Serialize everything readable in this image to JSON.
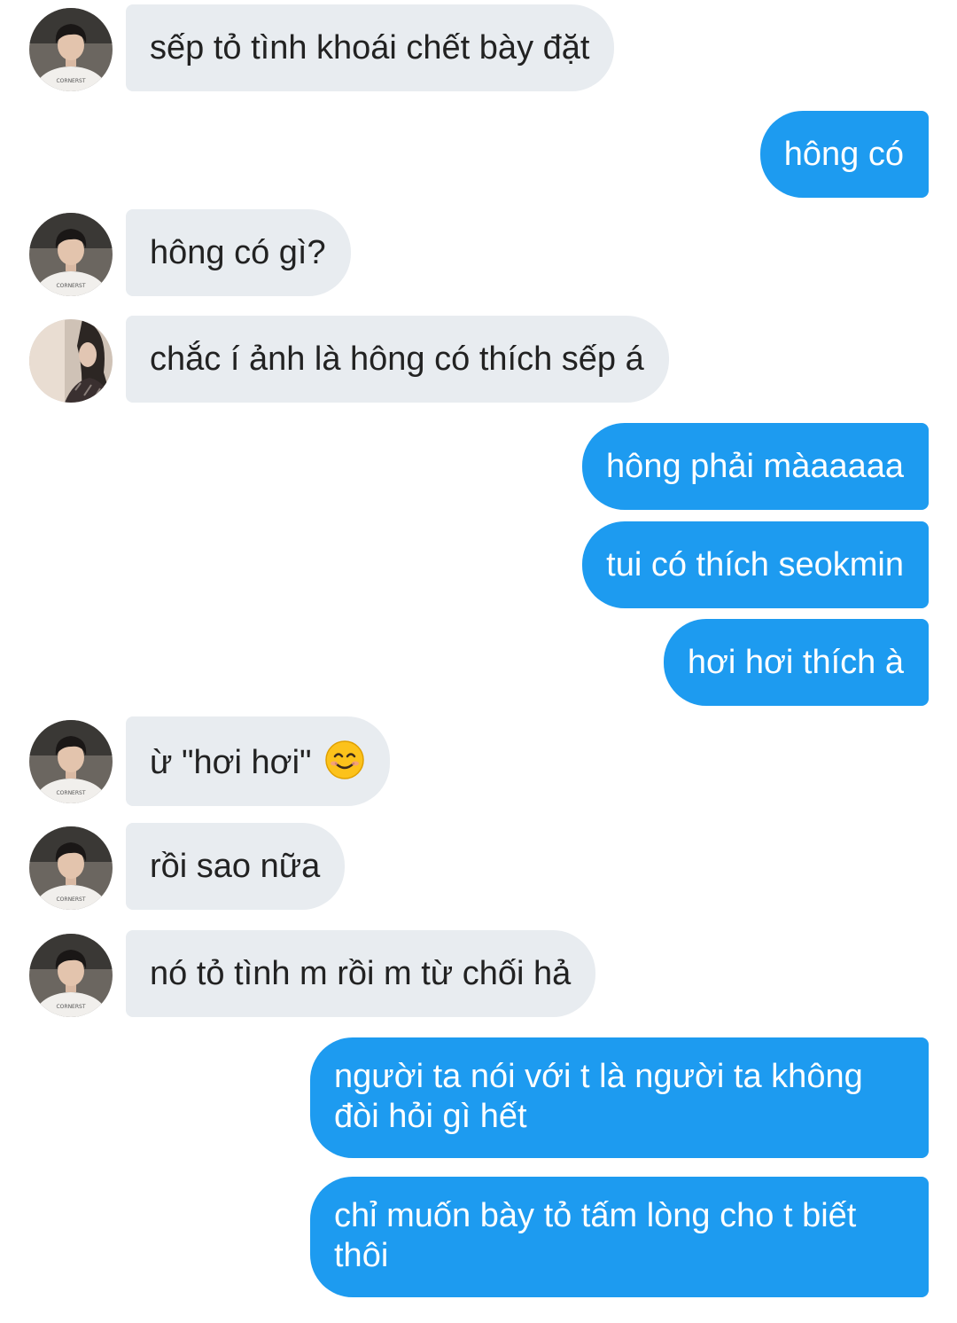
{
  "conversation": {
    "messages": [
      {
        "side": "in",
        "text": "sếp tỏ tình khoái chết bày đặt",
        "avatar": "boy-avatar"
      },
      {
        "side": "out",
        "text": "hông có"
      },
      {
        "side": "in",
        "text": "hông có gì?",
        "avatar": "boy-avatar"
      },
      {
        "side": "in",
        "text": "chắc í ảnh là hông có thích sếp á",
        "avatar": "girl-avatar"
      },
      {
        "side": "out",
        "text": "hông phải màaaaaa"
      },
      {
        "side": "out",
        "text": "tui có thích seokmin"
      },
      {
        "side": "out",
        "text": "hơi hơi thích à"
      },
      {
        "side": "in",
        "text": "ừ \"hơi hơi\"",
        "emoji": "smiling-face-emoji",
        "avatar": "boy-avatar"
      },
      {
        "side": "in",
        "text": "rồi sao nữa",
        "avatar": "boy-avatar"
      },
      {
        "side": "in",
        "text": "nó tỏ tình m rồi m từ chối hả",
        "avatar": "boy-avatar"
      },
      {
        "side": "out",
        "text": "người ta nói với t là người ta không đòi hỏi gì hết"
      },
      {
        "side": "out",
        "text": "chỉ muốn bày tỏ tấm lòng cho t biết thôi"
      }
    ]
  },
  "colors": {
    "incoming_bubble": "#e8ecf0",
    "outgoing_bubble": "#1d9bf0",
    "incoming_text": "#222222",
    "outgoing_text": "#ffffff"
  }
}
